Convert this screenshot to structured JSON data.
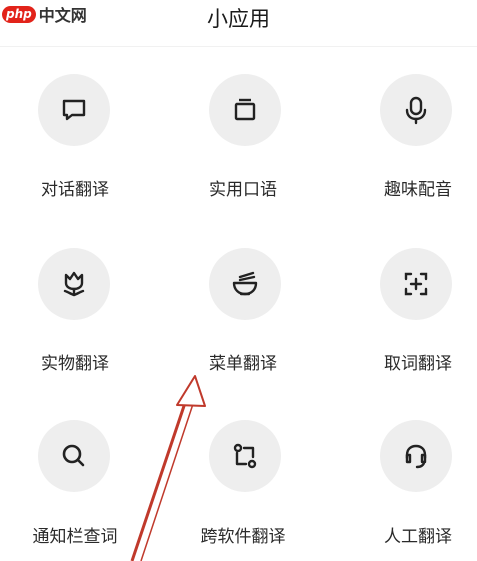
{
  "watermark": {
    "logo": "php",
    "text": "中文网"
  },
  "header": {
    "title": "小应用"
  },
  "apps": [
    {
      "label": "对话翻译",
      "icon": "chat-bubble-icon"
    },
    {
      "label": "实用口语",
      "icon": "card-stack-icon"
    },
    {
      "label": "趣味配音",
      "icon": "microphone-icon"
    },
    {
      "label": "实物翻译",
      "icon": "flower-icon"
    },
    {
      "label": "菜单翻译",
      "icon": "noodle-bowl-icon"
    },
    {
      "label": "取词翻译",
      "icon": "scan-plus-icon"
    },
    {
      "label": "通知栏查词",
      "icon": "search-icon"
    },
    {
      "label": "跨软件翻译",
      "icon": "route-icon"
    },
    {
      "label": "人工翻译",
      "icon": "headset-icon"
    }
  ],
  "colors": {
    "circle_bg": "#eeeeee",
    "icon_stroke": "#222222",
    "arrow": "#c0392b"
  }
}
